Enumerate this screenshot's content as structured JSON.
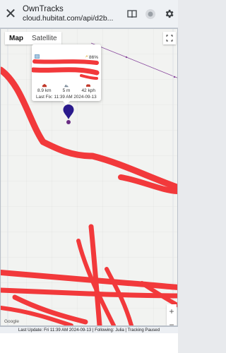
{
  "header": {
    "title": "OwnTracks",
    "url": "cloud.hubitat.com/api/d2b...",
    "close_icon": "close-icon",
    "icons": [
      "book-icon",
      "record-icon",
      "gear-icon"
    ]
  },
  "map": {
    "tabs": [
      "Map",
      "Satellite"
    ],
    "active_tab": "Map",
    "attribution": "Google",
    "zoom_in": "+",
    "zoom_out": "−",
    "info": {
      "battery": "86%",
      "stats": [
        {
          "icon": "home-icon",
          "value": "8.9 km"
        },
        {
          "icon": "altitude-icon",
          "value": "5 m"
        },
        {
          "icon": "car-icon",
          "value": "42 kph"
        }
      ],
      "last_fix": "Last Fix: 11:39 AM 2024-09-13"
    },
    "colors": {
      "redaction": "#f2393b",
      "marker": "#2a1a8c",
      "route": "#8a4a9e"
    }
  },
  "status": {
    "text": "Last Update: Fri 11:39 AM 2024-09-13 | Following: Julia | Tracking Paused"
  }
}
